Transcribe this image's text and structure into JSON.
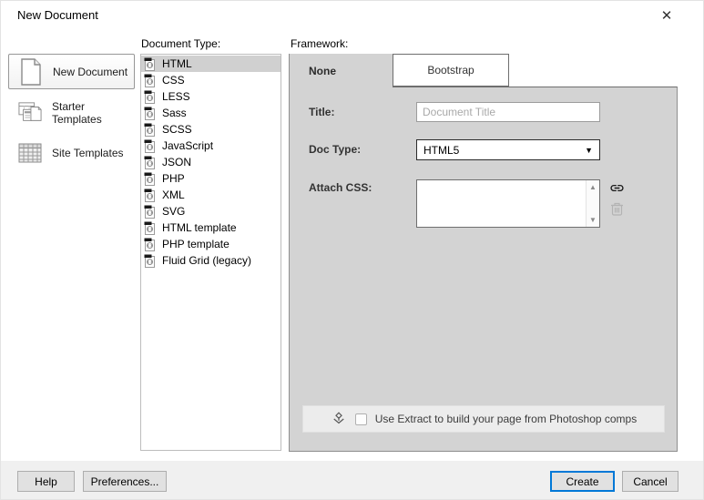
{
  "window": {
    "title": "New Document",
    "close_glyph": "✕"
  },
  "sidebar": {
    "items": [
      {
        "label": "New Document",
        "selected": true
      },
      {
        "label": "Starter Templates",
        "selected": false
      },
      {
        "label": "Site Templates",
        "selected": false
      }
    ]
  },
  "document_type": {
    "label": "Document Type:",
    "selected_index": 0,
    "items": [
      "HTML",
      "CSS",
      "LESS",
      "Sass",
      "SCSS",
      "JavaScript",
      "JSON",
      "PHP",
      "XML",
      "SVG",
      "HTML template",
      "PHP template",
      "Fluid Grid (legacy)"
    ]
  },
  "framework": {
    "label": "Framework:",
    "tabs": [
      {
        "label": "None",
        "active": true
      },
      {
        "label": "Bootstrap",
        "active": false
      }
    ],
    "form": {
      "title_label": "Title:",
      "title_value": "",
      "title_placeholder": "Document Title",
      "doc_type_label": "Doc Type:",
      "doc_type_value": "HTML5",
      "attach_css_label": "Attach CSS:",
      "attach_css_items": []
    },
    "extract": {
      "label": "Use Extract to build your page from Photoshop comps",
      "checked": false
    }
  },
  "footer": {
    "help_label": "Help",
    "preferences_label": "Preferences...",
    "create_label": "Create",
    "cancel_label": "Cancel"
  },
  "colors": {
    "panel_gray": "#d3d3d3",
    "selection_gray": "#d0d0d0",
    "footer_gray": "#f0f0f0",
    "accent_blue": "#0078d7"
  }
}
